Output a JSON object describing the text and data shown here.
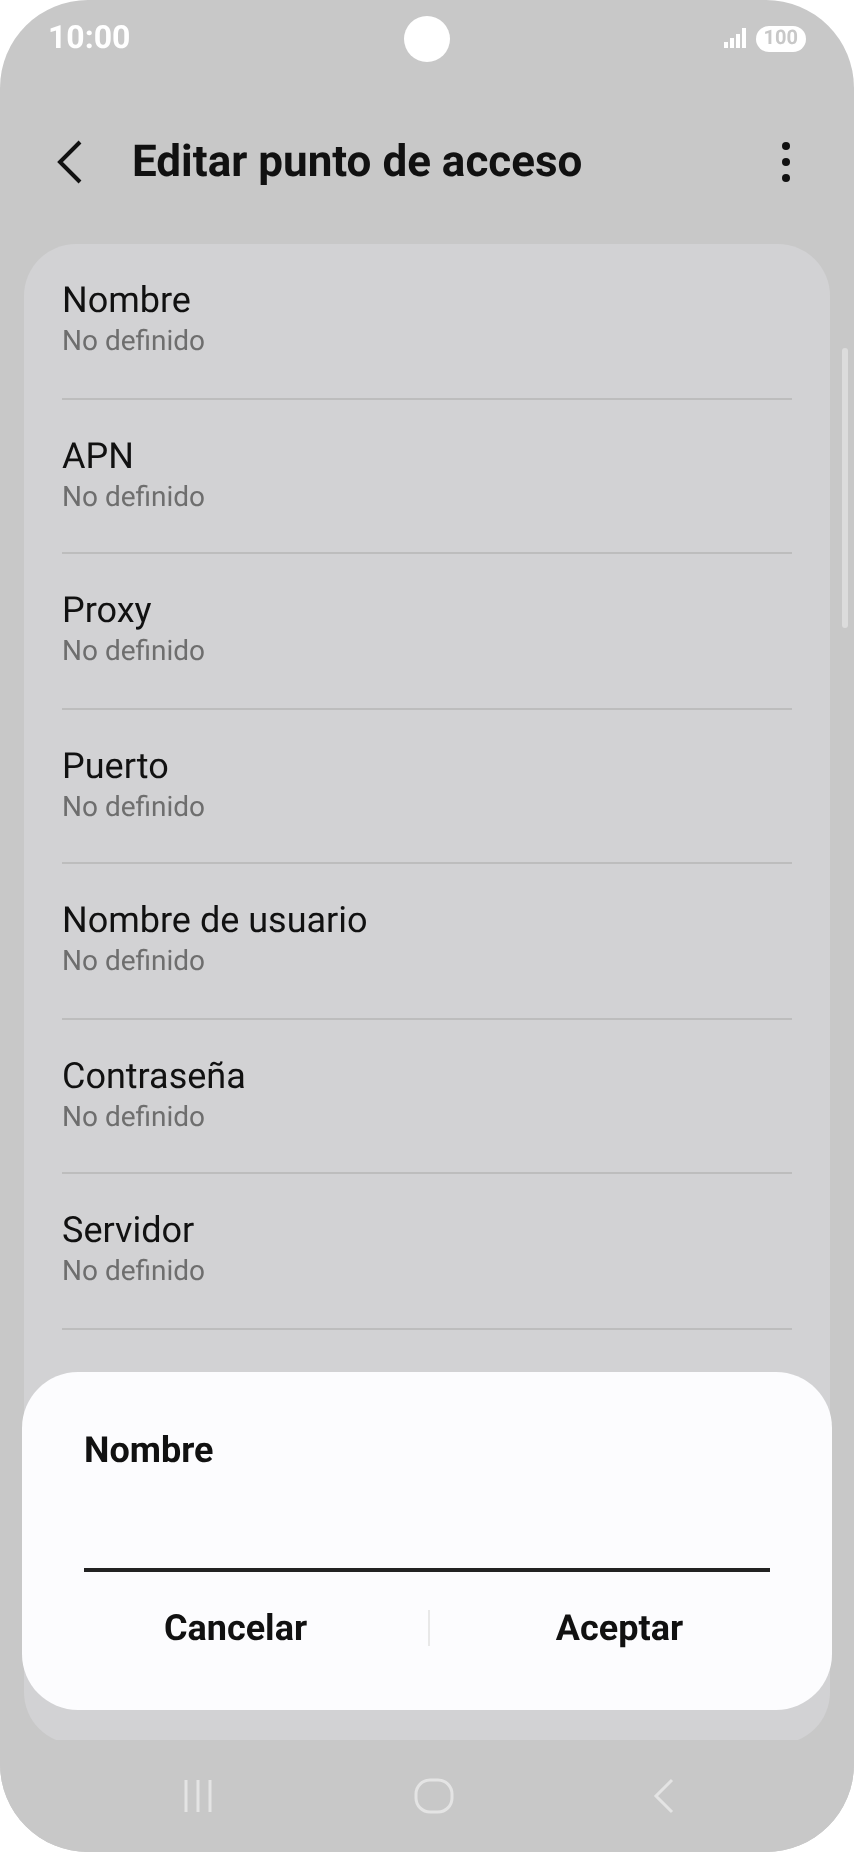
{
  "status_bar": {
    "time": "10:00",
    "battery": "100"
  },
  "header": {
    "title": "Editar punto de acceso"
  },
  "settings": [
    {
      "label": "Nombre",
      "value": "No definido"
    },
    {
      "label": "APN",
      "value": "No definido"
    },
    {
      "label": "Proxy",
      "value": "No definido"
    },
    {
      "label": "Puerto",
      "value": "No definido"
    },
    {
      "label": "Nombre de usuario",
      "value": "No definido"
    },
    {
      "label": "Contraseña",
      "value": "No definido"
    },
    {
      "label": "Servidor",
      "value": "No definido"
    }
  ],
  "dialog": {
    "title": "Nombre",
    "buttons": [
      "Cancelar",
      "Aceptar"
    ]
  }
}
